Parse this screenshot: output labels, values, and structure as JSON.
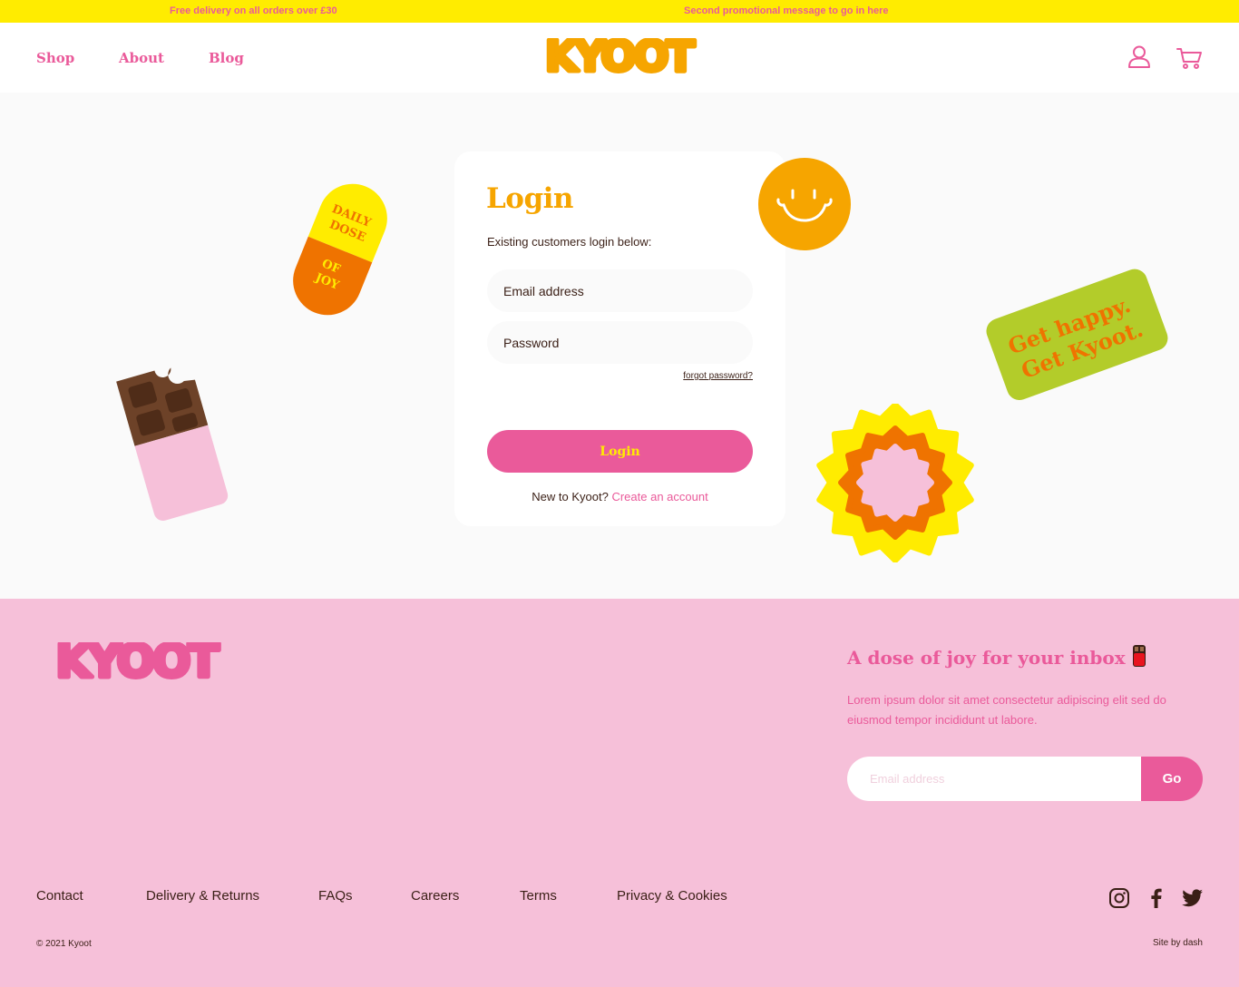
{
  "promo": {
    "message_1": "Free delivery on all orders over £30",
    "message_2": "Second promotional message to go in here"
  },
  "header": {
    "nav": [
      "Shop",
      "About",
      "Blog"
    ],
    "logo_text": "KYOOT",
    "icons": [
      "user-icon",
      "cart-icon"
    ]
  },
  "login": {
    "title": "Login",
    "subtitle": "Existing customers login below:",
    "email_placeholder": "Email address",
    "password_placeholder": "Password",
    "forgot_label": "forgot password?",
    "button_label": "Login",
    "new_prefix": "New to Kyoot?",
    "create_link": "Create an account"
  },
  "stickers": {
    "pill_top": [
      "DAILY",
      "DOSE"
    ],
    "pill_bottom": [
      "OF",
      "JOY"
    ],
    "badge": [
      "Get happy.",
      "Get Kyoot."
    ]
  },
  "footer": {
    "logo_text": "KYOOT",
    "newsletter": {
      "title": "A dose of joy for your inbox",
      "text": "Lorem ipsum dolor sit amet consectetur adipiscing elit sed do eiusmod tempor incididunt ut labore.",
      "placeholder": "Email address",
      "button_label": "Go"
    },
    "links": [
      "Contact",
      "Delivery & Returns",
      "FAQs",
      "Careers",
      "Terms",
      "Privacy & Cookies"
    ],
    "social": [
      "instagram-icon",
      "facebook-icon",
      "twitter-icon"
    ],
    "copyright": "© 2021 Kyoot",
    "credit": "Site by dash"
  },
  "colors": {
    "promo_bg": "#ffec00",
    "brand_pink": "#ea5a9a",
    "brand_orange": "#f6a500",
    "footer_bg": "#f6c0d9",
    "text_dark": "#3a1f16"
  }
}
